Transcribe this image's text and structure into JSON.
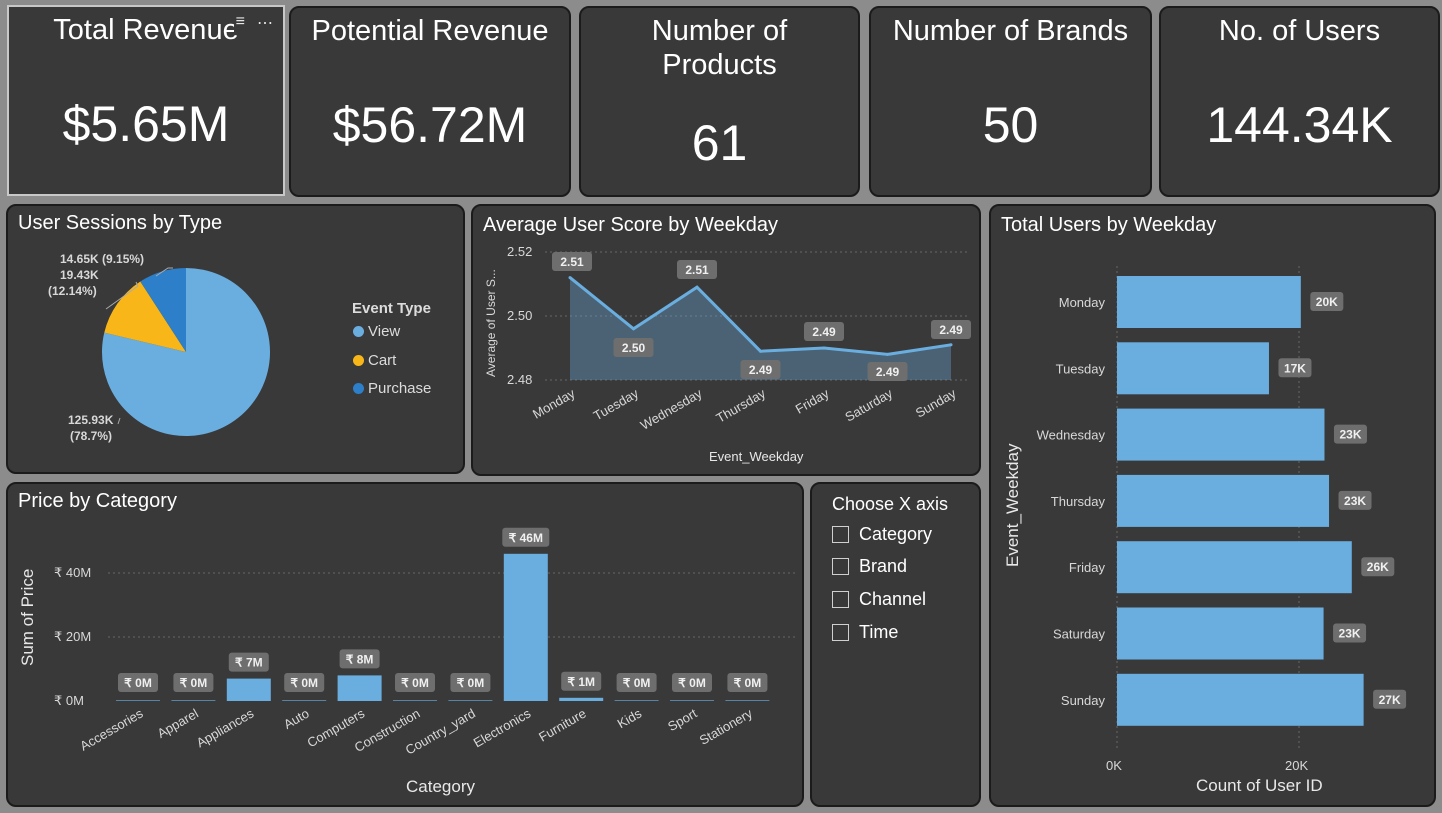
{
  "kpis": [
    {
      "title": "Total Revenue",
      "value": "$5.65M"
    },
    {
      "title": "Potential Revenue",
      "value": "$56.72M"
    },
    {
      "title": "Number of Products",
      "value": "61"
    },
    {
      "title": "Number of Brands",
      "value": "50"
    },
    {
      "title": "No. of Users",
      "value": "144.34K"
    }
  ],
  "visual_toolbar": {
    "filter_icon": "filter-icon",
    "more_icon": "more-options-icon",
    "more_label": "⋯",
    "filter_label": "≡"
  },
  "sessions": {
    "title": "User Sessions by Type",
    "legend_title": "Event Type",
    "legend": [
      {
        "label": "View",
        "color": "#6aaee0"
      },
      {
        "label": "Cart",
        "color": "#f8b619"
      },
      {
        "label": "Purchase",
        "color": "#2c7fc8"
      }
    ],
    "labels": {
      "purchase_value": "14.65K (9.15%)",
      "cart_value": "19.43K",
      "cart_pct": "(12.14%)",
      "view_value": "125.93K",
      "view_pct": "(78.7%)"
    }
  },
  "avg_score": {
    "title": "Average User Score by Weekday",
    "xlabel": "Event_Weekday",
    "ylabel": "Average of User S...",
    "y_ticks": [
      "2.52",
      "2.50",
      "2.48"
    ],
    "data_labels": [
      "2.51",
      "2.50",
      "2.51",
      "2.49",
      "2.49",
      "2.49",
      "2.49"
    ]
  },
  "total_users": {
    "title": "Total Users by Weekday",
    "xlabel": "Count of User ID",
    "ylabel": "Event_Weekday",
    "x_ticks": [
      "0K",
      "20K"
    ],
    "data_labels": [
      "20K",
      "17K",
      "23K",
      "23K",
      "26K",
      "23K",
      "27K"
    ]
  },
  "price": {
    "title": "Price by Category",
    "xlabel": "Category",
    "ylabel": "Sum of Price",
    "y_ticks": [
      "₹ 40M",
      "₹ 20M",
      "₹ 0M"
    ],
    "data_labels": [
      "₹ 0M",
      "₹ 0M",
      "₹ 7M",
      "₹ 0M",
      "₹ 8M",
      "₹ 0M",
      "₹ 0M",
      "₹ 46M",
      "₹ 1M",
      "₹ 0M",
      "₹ 0M",
      "₹ 0M"
    ]
  },
  "slicer": {
    "title": "Choose X axis",
    "options": [
      "Category",
      "Brand",
      "Channel",
      "Time"
    ]
  },
  "chart_data": [
    {
      "type": "pie",
      "title": "User Sessions by Type",
      "legend_title": "Event Type",
      "categories": [
        "View",
        "Cart",
        "Purchase"
      ],
      "values": [
        125930,
        19430,
        14650
      ],
      "percent": [
        78.7,
        12.14,
        9.15
      ],
      "colors": [
        "#6aaee0",
        "#f8b619",
        "#2c7fc8"
      ],
      "legend": "right"
    },
    {
      "type": "area",
      "title": "Average User Score by Weekday",
      "xlabel": "Event_Weekday",
      "ylabel": "Average of User S...",
      "categories": [
        "Monday",
        "Tuesday",
        "Wednesday",
        "Thursday",
        "Friday",
        "Saturday",
        "Sunday"
      ],
      "values": [
        2.512,
        2.496,
        2.509,
        2.489,
        2.49,
        2.488,
        2.491
      ],
      "ylim": [
        2.48,
        2.52
      ],
      "grid": true,
      "color": "#6aaee0"
    },
    {
      "type": "bar",
      "orientation": "horizontal",
      "title": "Total Users by Weekday",
      "xlabel": "Count of User ID",
      "ylabel": "Event_Weekday",
      "categories": [
        "Monday",
        "Tuesday",
        "Wednesday",
        "Thursday",
        "Friday",
        "Saturday",
        "Sunday"
      ],
      "values": [
        20200,
        16700,
        22800,
        23300,
        25800,
        22700,
        27100
      ],
      "xlim": [
        0,
        30000
      ],
      "grid": true,
      "color": "#6aaee0"
    },
    {
      "type": "bar",
      "title": "Price by Category",
      "xlabel": "Category",
      "ylabel": "Sum of Price",
      "categories": [
        "Accessories",
        "Apparel",
        "Appliances",
        "Auto",
        "Computers",
        "Construction",
        "Country_yard",
        "Electronics",
        "Furniture",
        "Kids",
        "Sport",
        "Stationery"
      ],
      "values": [
        0.2,
        0.2,
        7,
        0.2,
        8,
        0.2,
        0.2,
        46,
        1,
        0.2,
        0.2,
        0.2
      ],
      "unit": "₹ M",
      "ylim": [
        0,
        48
      ],
      "grid": true,
      "color": "#6aaee0"
    }
  ]
}
